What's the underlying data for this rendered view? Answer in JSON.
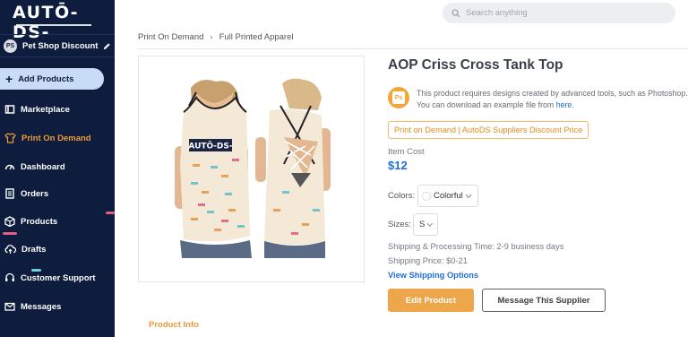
{
  "sidebar": {
    "logo": "AUTŌ-DS-",
    "store": {
      "avatar": "PS",
      "name": "Pet Shop Discount"
    },
    "add_products": "Add Products",
    "items": [
      {
        "label": "Marketplace",
        "icon": "marketplace-icon"
      },
      {
        "label": "Print On Demand",
        "icon": "shirt-icon"
      },
      {
        "label": "Dashboard",
        "icon": "dashboard-gauge-icon"
      },
      {
        "label": "Orders",
        "icon": "orders-list-icon"
      },
      {
        "label": "Products",
        "icon": "products-box-icon"
      },
      {
        "label": "Drafts",
        "icon": "drafts-cloud-icon"
      },
      {
        "label": "Customer Support",
        "icon": "support-headset-icon"
      },
      {
        "label": "Messages",
        "icon": "messages-mail-icon"
      }
    ]
  },
  "search": {
    "placeholder": "Search anything"
  },
  "breadcrumb": {
    "items": [
      "Print On Demand",
      "Full Printed Apparel"
    ]
  },
  "product": {
    "image_logo": "AUTŌ-DS-",
    "title": "AOP Criss Cross Tank Top",
    "ps_badge": "Ps",
    "design_note_line1": "This product requires designs created by advanced tools, such as Photoshop.",
    "design_note_line2": "You can download an example file from",
    "design_note_link": "here.",
    "tag": "Print on Demand | AutoDS Suppliers Discount Price",
    "cost_label": "Item Cost",
    "cost": "$12",
    "colors_label": "Colors:",
    "color_value": "Colorful",
    "sizes_label": "Sizes:",
    "size_value": "S",
    "shipping_time": "Shipping & Processing Time: 2-9 business days",
    "shipping_price": "Shipping Price: $0-21",
    "shipping_link": "View Shipping Options",
    "edit_button": "Edit Product",
    "message_button": "Message This Supplier",
    "tab_info": "Product Info"
  },
  "colors": {
    "sidebar_bg": "#0e1d3d",
    "active_orange": "#ec9b3b",
    "link_blue": "#1e6ed6",
    "edit_button": "#eea64b"
  }
}
